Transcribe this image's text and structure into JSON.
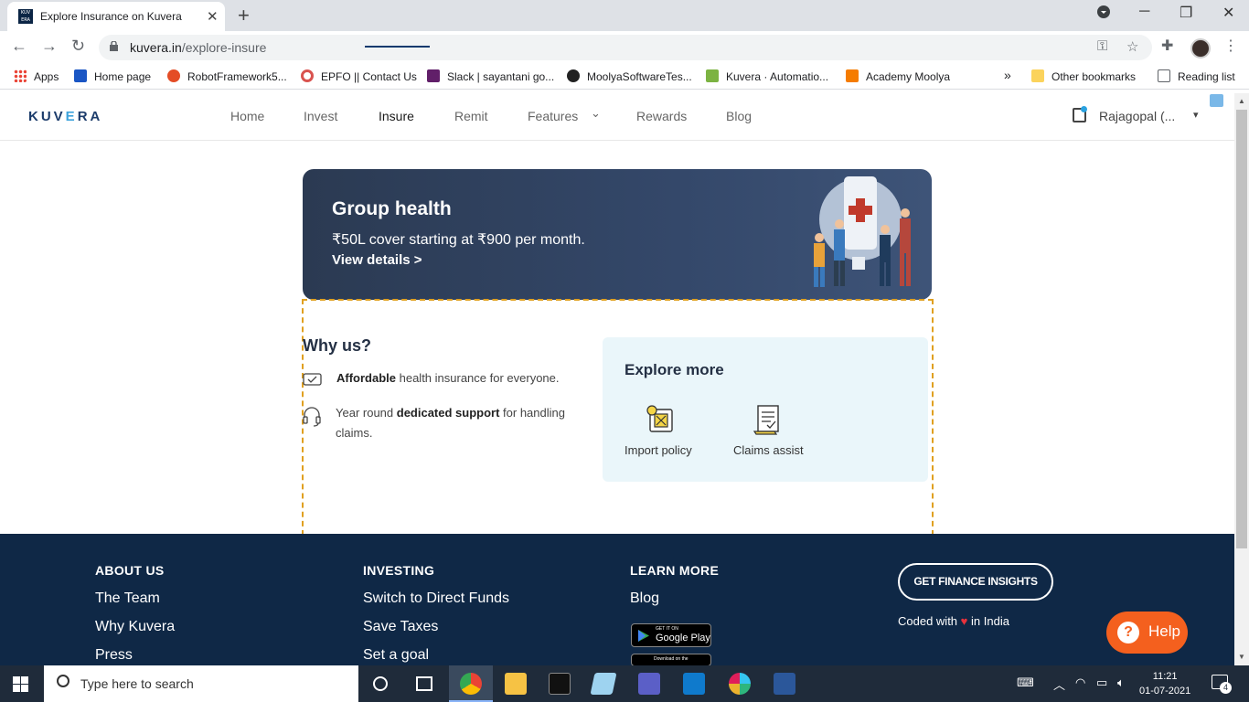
{
  "browser": {
    "tab_title": "Explore Insurance on Kuvera",
    "favicon_text": "KUV ERA",
    "url_host": "kuvera.in",
    "url_path": "/explore-insure"
  },
  "bookmarks": {
    "items": [
      {
        "label": "Apps",
        "icon": "apps-grid-icon",
        "color": "#4285f4"
      },
      {
        "label": "Home page",
        "icon": "home-page-icon",
        "color": "#1a56c4"
      },
      {
        "label": "RobotFramework5...",
        "icon": "robot-icon",
        "color": "#e44d26"
      },
      {
        "label": "EPFO || Contact Us",
        "icon": "epfo-icon",
        "color": "#d9534f"
      },
      {
        "label": "Slack | sayantani go...",
        "icon": "slack-icon",
        "color": "#611f69"
      },
      {
        "label": "MoolyaSoftwareTes...",
        "icon": "github-icon",
        "color": "#222222"
      },
      {
        "label": "Kuvera · Automatio...",
        "icon": "kuvera-bookmark-icon",
        "color": "#7cb342"
      },
      {
        "label": "Academy Moolya",
        "icon": "moolya-icon",
        "color": "#f57c00"
      }
    ],
    "more": "»",
    "other": "Other bookmarks",
    "reading_list": "Reading list"
  },
  "header": {
    "logo_pre": "KUV",
    "logo_e": "E",
    "logo_post": "RA",
    "nav": [
      "Home",
      "Invest",
      "Insure",
      "Remit",
      "Features",
      "Rewards",
      "Blog"
    ],
    "active_nav": "Insure",
    "features_chevron": "⌄",
    "user_name": "Rajagopal (..."
  },
  "banner": {
    "title": "Group health",
    "subtitle": "₹50L cover starting at ₹900 per month.",
    "link": "View details >"
  },
  "why_us": {
    "title": "Why us?",
    "item1_bold": "Affordable",
    "item1_rest": " health insurance for everyone.",
    "item2_pre": "Year round ",
    "item2_bold": "dedicated support",
    "item2_rest": " for handling claims."
  },
  "explore": {
    "title": "Explore more",
    "items": [
      "Import policy",
      "Claims assist"
    ]
  },
  "footer": {
    "about_head": "ABOUT US",
    "about_links": [
      "The Team",
      "Why Kuvera",
      "Press"
    ],
    "investing_head": "INVESTING",
    "investing_links": [
      "Switch to Direct Funds",
      "Save Taxes",
      "Set a goal"
    ],
    "learn_head": "LEARN MORE",
    "learn_links": [
      "Blog"
    ],
    "google_play_small": "GET IT ON",
    "google_play": "Google Play",
    "app_store_small": "Download on the",
    "insights_button": "GET FINANCE INSIGHTS",
    "coded_pre": "Coded with",
    "coded_post": "in India",
    "help": "Help"
  },
  "taskbar": {
    "search_placeholder": "Type here to search",
    "time": "11:21",
    "date": "01-07-2021",
    "notifications": "4"
  },
  "colors": {
    "footer_bg": "#0f2846",
    "help_orange": "#f4601e",
    "banner_bg": "#2b3a52",
    "explore_card_bg": "#eaf6fa",
    "dashed_border": "#e0a020"
  }
}
